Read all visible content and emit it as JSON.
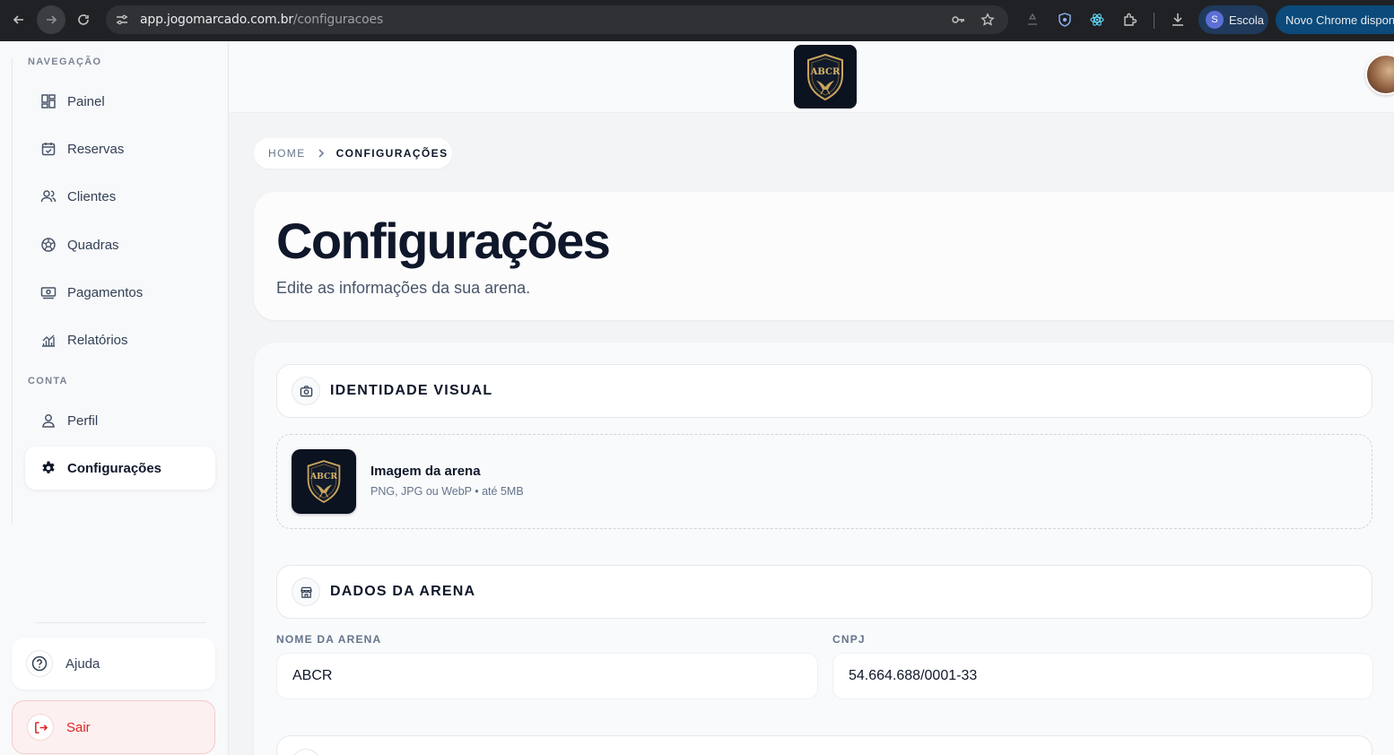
{
  "browser": {
    "url_host": "app.jogomarcado.com.br",
    "url_path": "/configuracoes",
    "profile_initial": "S",
    "profile_label": "Escola",
    "update_label": "Novo Chrome disponível"
  },
  "sidebar": {
    "nav_section": "NAVEGAÇÃO",
    "nav_items": [
      {
        "label": "Painel",
        "icon": "dashboard-icon"
      },
      {
        "label": "Reservas",
        "icon": "calendar-check-icon"
      },
      {
        "label": "Clientes",
        "icon": "users-icon"
      },
      {
        "label": "Quadras",
        "icon": "ball-icon"
      },
      {
        "label": "Pagamentos",
        "icon": "money-icon"
      },
      {
        "label": "Relatórios",
        "icon": "chart-icon"
      }
    ],
    "account_section": "CONTA",
    "account_items": [
      {
        "label": "Perfil",
        "icon": "user-icon"
      },
      {
        "label": "Configurações",
        "icon": "gear-icon",
        "active": true
      }
    ],
    "help_label": "Ajuda",
    "logout_label": "Sair"
  },
  "topbar": {
    "logo_text": "ABCR"
  },
  "breadcrumb": {
    "home": "HOME",
    "current": "CONFIGURAÇÕES"
  },
  "hero": {
    "title": "Configurações",
    "subtitle": "Edite as informações da sua arena."
  },
  "identity": {
    "heading": "IDENTIDADE VISUAL",
    "image_title": "Imagem da arena",
    "image_hint": "PNG, JPG ou WebP • até 5MB"
  },
  "arena": {
    "heading": "DADOS DA ARENA",
    "name_label": "NOME DA ARENA",
    "name_value": "ABCR",
    "cnpj_label": "CNPJ",
    "cnpj_value": "54.664.688/0001-33"
  },
  "colors": {
    "chrome_bg": "#202124",
    "logo_bg": "#0b1220",
    "logo_gold": "#c9a45c",
    "danger": "#dc2626"
  }
}
